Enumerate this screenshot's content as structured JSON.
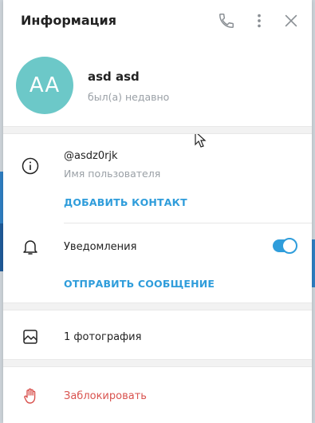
{
  "header": {
    "title": "Информация",
    "phone_icon": "phone-icon",
    "more_icon": "more-vertical-icon",
    "close_icon": "close-icon"
  },
  "profile": {
    "avatar_initials": "AA",
    "avatar_color": "#6cc8c8",
    "name": "asd asd",
    "status": "был(а) недавно"
  },
  "info": {
    "username": "@asdz0rjk",
    "username_label": "Имя пользователя",
    "add_contact": "ДОБАВИТЬ КОНТАКТ"
  },
  "notifications": {
    "label": "Уведомления",
    "enabled": true,
    "send_message": "ОТПРАВИТЬ СООБЩЕНИЕ"
  },
  "media": {
    "photos": "1 фотография"
  },
  "block": {
    "label": "Заблокировать",
    "color": "#d9534f"
  },
  "colors": {
    "accent": "#2f9ddb",
    "danger": "#d9534f"
  }
}
